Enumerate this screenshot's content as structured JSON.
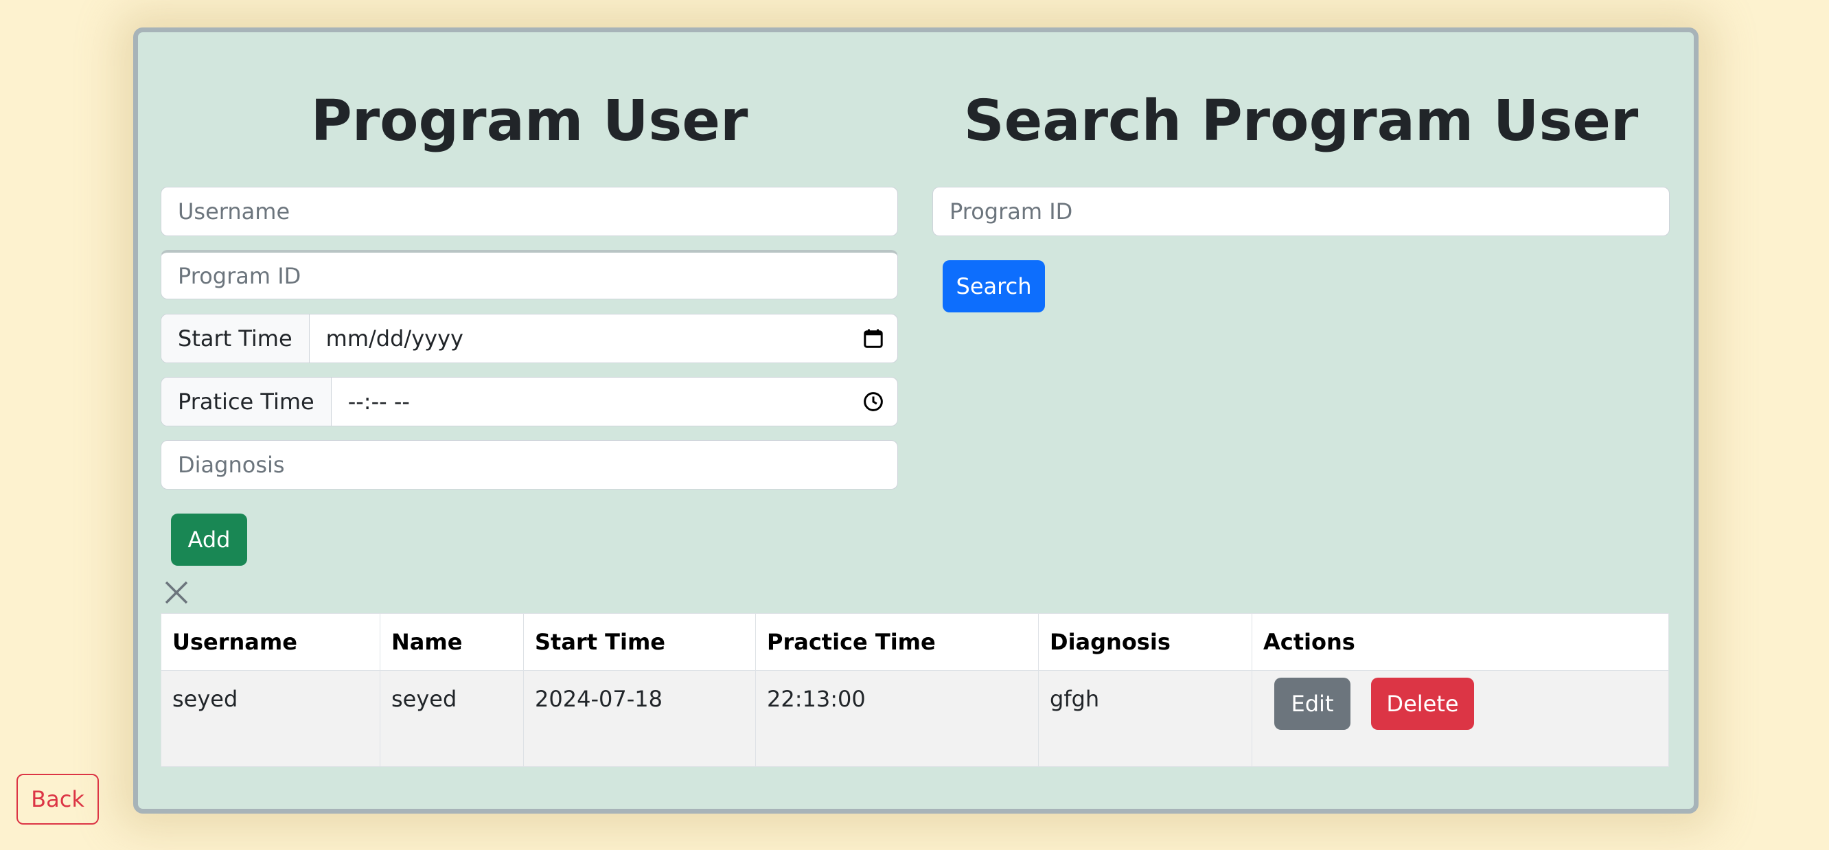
{
  "form": {
    "title": "Program User",
    "username_placeholder": "Username",
    "program_id_placeholder": "Program ID",
    "start_time_label": "Start Time",
    "start_time_value": "mm/dd/yyyy",
    "practice_time_label": "Pratice Time",
    "practice_time_value": "--:-- --",
    "diagnosis_placeholder": "Diagnosis",
    "add_label": "Add"
  },
  "search": {
    "title": "Search Program User",
    "program_id_placeholder": "Program ID",
    "search_label": "Search"
  },
  "table": {
    "headers": [
      "Username",
      "Name",
      "Start Time",
      "Practice Time",
      "Diagnosis",
      "Actions"
    ],
    "rows": [
      {
        "username": "seyed",
        "name": "seyed",
        "start_time": "2024-07-18",
        "practice_time": "22:13:00",
        "diagnosis": "gfgh",
        "edit_label": "Edit",
        "delete_label": "Delete"
      }
    ]
  },
  "back_label": "Back",
  "colors": {
    "page_bg": "#fdf2cf",
    "panel_bg": "#d2e6dd",
    "add_button": "#198754",
    "search_button": "#0d6efd",
    "edit_button": "#6c757d",
    "delete_button": "#dc3545",
    "back_button": "#dc3545"
  },
  "icons": {
    "calendar": "calendar-icon",
    "clock": "clock-icon",
    "close": "close-icon"
  }
}
